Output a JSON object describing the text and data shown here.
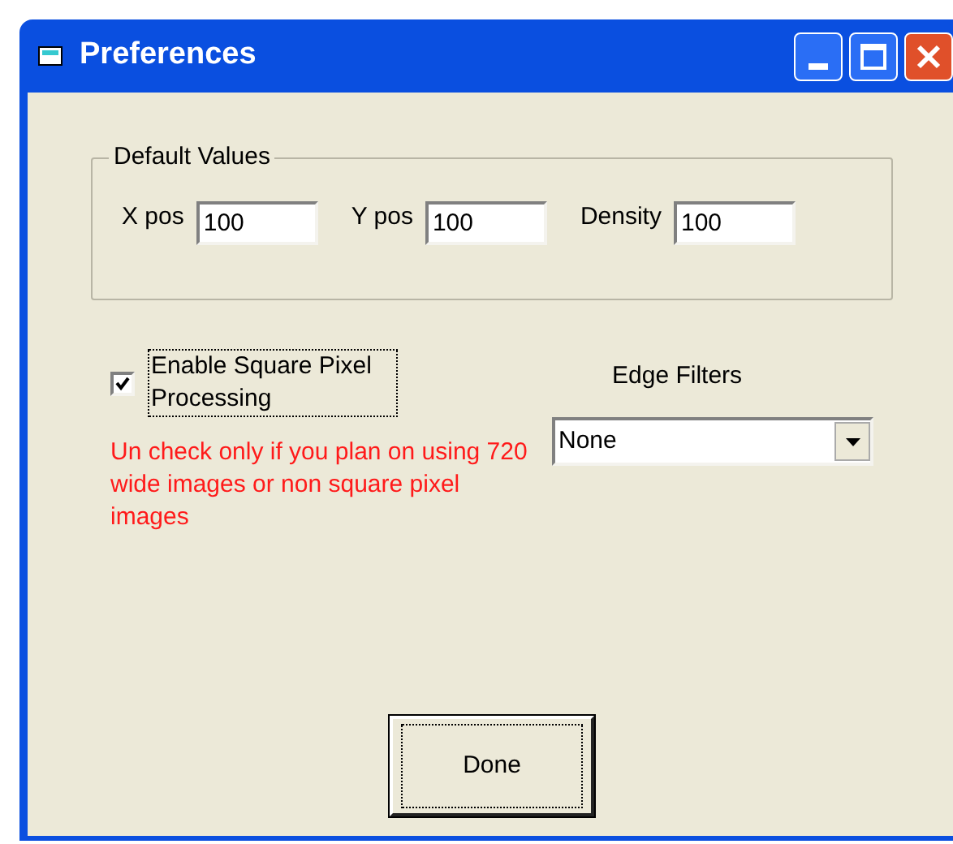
{
  "window": {
    "title": "Preferences"
  },
  "default_values": {
    "title": "Default Values",
    "fields": [
      {
        "label": "X pos",
        "value": "100"
      },
      {
        "label": "Y pos",
        "value": "100"
      },
      {
        "label": "Density",
        "value": "100"
      }
    ]
  },
  "square_pixel": {
    "label": "Enable Square Pixel Processing",
    "checked": true,
    "note": "Un check only if you plan on using 720 wide images or non square pixel images"
  },
  "edge_filters": {
    "label": "Edge Filters",
    "value": "None"
  },
  "buttons": [
    "Done"
  ]
}
